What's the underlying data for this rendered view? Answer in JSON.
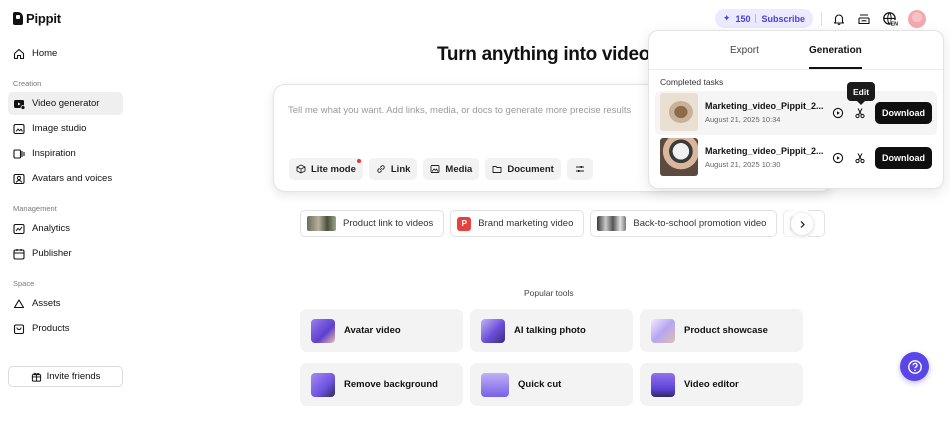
{
  "app": {
    "name": "Pippit"
  },
  "sidebar": {
    "home": "Home",
    "sections": [
      {
        "label": "Creation",
        "items": [
          {
            "label": "Video generator",
            "icon": "video-generator-icon",
            "active": true
          },
          {
            "label": "Image studio",
            "icon": "image-studio-icon"
          },
          {
            "label": "Inspiration",
            "icon": "inspiration-icon"
          },
          {
            "label": "Avatars and voices",
            "icon": "avatar-icon"
          }
        ]
      },
      {
        "label": "Management",
        "items": [
          {
            "label": "Analytics",
            "icon": "analytics-icon"
          },
          {
            "label": "Publisher",
            "icon": "calendar-icon"
          }
        ]
      },
      {
        "label": "Space",
        "items": [
          {
            "label": "Assets",
            "icon": "cloud-icon"
          },
          {
            "label": "Products",
            "icon": "bag-icon"
          }
        ]
      }
    ],
    "invite": "Invite friends"
  },
  "topbar": {
    "credits": "150",
    "subscribe": "Subscribe",
    "language": "EN",
    "accent": "#4b3fd6"
  },
  "main": {
    "title": "Turn anything into video",
    "prompt_placeholder": "Tell me what you want. Add links, media, or docs to generate more precise results",
    "tools": {
      "lite": "Lite mode",
      "link": "Link",
      "media": "Media",
      "document": "Document"
    },
    "suggestions": [
      {
        "label": "Product link to videos"
      },
      {
        "label": "Brand marketing video",
        "badge": "P"
      },
      {
        "label": "Back-to-school promotion video"
      }
    ],
    "popular_label": "Popular tools",
    "popular_tools": [
      {
        "label": "Avatar video"
      },
      {
        "label": "AI talking photo"
      },
      {
        "label": "Product showcase"
      },
      {
        "label": "Remove background"
      },
      {
        "label": "Quick cut"
      },
      {
        "label": "Video editor"
      }
    ]
  },
  "popover": {
    "tabs": [
      {
        "label": "Export",
        "active": false
      },
      {
        "label": "Generation",
        "active": true
      }
    ],
    "section": "Completed tasks",
    "tooltip": "Edit",
    "tasks": [
      {
        "name": "Marketing_video_Pippit_2...",
        "date": "August 21, 2025 10:34",
        "download": "Download"
      },
      {
        "name": "Marketing_video_Pippit_2...",
        "date": "August 21, 2025 10:30",
        "download": "Download"
      }
    ]
  }
}
